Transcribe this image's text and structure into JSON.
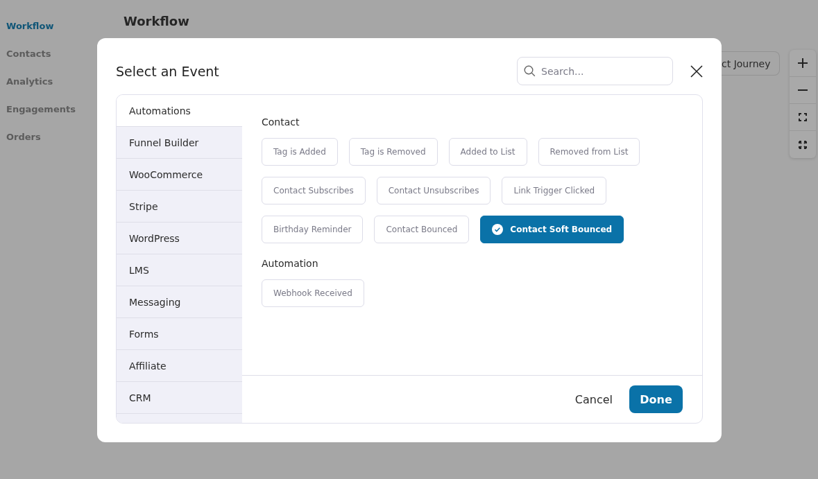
{
  "sidebar": {
    "items": [
      {
        "label": "Workflow",
        "selected": true
      },
      {
        "label": "Contacts",
        "selected": false
      },
      {
        "label": "Analytics",
        "selected": false
      },
      {
        "label": "Engagements",
        "selected": false
      },
      {
        "label": "Orders",
        "selected": false
      }
    ]
  },
  "page": {
    "title": "Workflow",
    "journey_button": "ct Journey"
  },
  "zoom_controls": [
    {
      "kind": "plus"
    },
    {
      "kind": "minus"
    },
    {
      "kind": "fit"
    },
    {
      "kind": "expand"
    }
  ],
  "dialog": {
    "title": "Select an Event",
    "search": {
      "placeholder": "Search..."
    },
    "categories": [
      {
        "label": "Automations",
        "selected": true
      },
      {
        "label": "Funnel Builder",
        "selected": false
      },
      {
        "label": "WooCommerce",
        "selected": false
      },
      {
        "label": "Stripe",
        "selected": false
      },
      {
        "label": "WordPress",
        "selected": false
      },
      {
        "label": "LMS",
        "selected": false
      },
      {
        "label": "Messaging",
        "selected": false
      },
      {
        "label": "Forms",
        "selected": false
      },
      {
        "label": "Affiliate",
        "selected": false
      },
      {
        "label": "CRM",
        "selected": false
      }
    ],
    "groups": [
      {
        "heading": "Contact",
        "events": [
          {
            "label": "Tag is Added",
            "selected": false
          },
          {
            "label": "Tag is Removed",
            "selected": false
          },
          {
            "label": "Added to List",
            "selected": false
          },
          {
            "label": "Removed from List",
            "selected": false
          },
          {
            "label": "Contact Subscribes",
            "selected": false
          },
          {
            "label": "Contact Unsubscribes",
            "selected": false
          },
          {
            "label": "Link Trigger Clicked",
            "selected": false
          },
          {
            "label": "Birthday Reminder",
            "selected": false
          },
          {
            "label": "Contact Bounced",
            "selected": false
          },
          {
            "label": "Contact Soft Bounced",
            "selected": true
          }
        ]
      },
      {
        "heading": "Automation",
        "events": [
          {
            "label": "Webhook Received",
            "selected": false
          }
        ]
      }
    ],
    "buttons": {
      "cancel": "Cancel",
      "done": "Done"
    }
  }
}
